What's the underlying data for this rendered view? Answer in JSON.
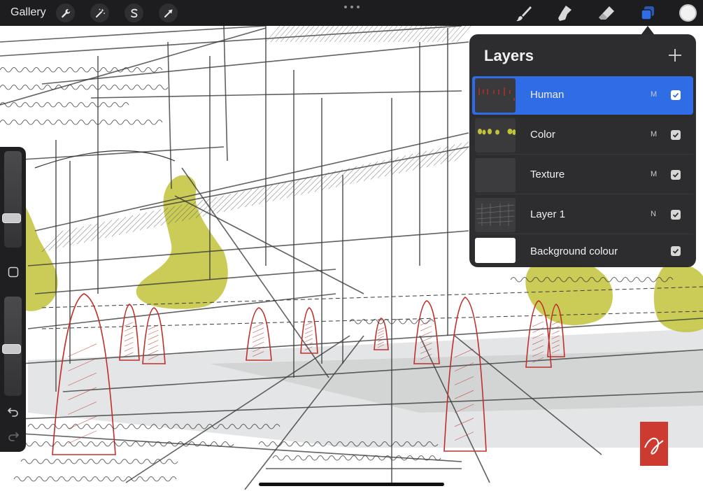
{
  "toolbar": {
    "gallery_label": "Gallery",
    "left_tools": [
      "wrench-icon",
      "magic-wand-icon",
      "selection-icon",
      "transform-arrow-icon"
    ],
    "right_tools": [
      "brush-icon",
      "smudge-icon",
      "eraser-icon",
      "layers-icon"
    ],
    "active_tool_color": "#2f6de6",
    "current_color": "#f2f2f2"
  },
  "layers_panel": {
    "title": "Layers",
    "add_icon": "plus-icon",
    "selected_color": "#2f6de6",
    "layers": [
      {
        "name": "Human",
        "blend": "M",
        "visible": true,
        "selected": true
      },
      {
        "name": "Color",
        "blend": "M",
        "visible": true,
        "selected": false
      },
      {
        "name": "Texture",
        "blend": "M",
        "visible": true,
        "selected": false
      },
      {
        "name": "Layer 1",
        "blend": "N",
        "visible": true,
        "selected": false
      },
      {
        "name": "Background colour",
        "blend": "",
        "visible": true,
        "selected": false
      }
    ]
  },
  "sidebar": {
    "brush_size": 0.72,
    "opacity": 0.53,
    "modify_icon": "square-icon",
    "undo_icon": "undo-icon",
    "redo_icon": "redo-icon"
  },
  "colors": {
    "sketch_red": "#c0302a",
    "foliage_yellow": "#c2c23a",
    "ink": "#3a3a3a",
    "signature_red": "#cc3a30"
  }
}
